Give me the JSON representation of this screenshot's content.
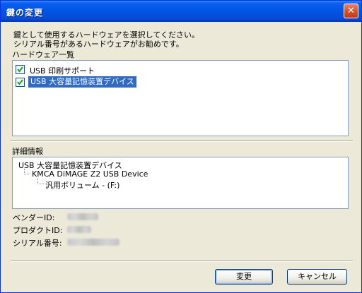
{
  "window": {
    "title": "鍵の変更",
    "close_glyph": "✕"
  },
  "instructions": {
    "line1": "鍵として使用するハードウェアを選択してください。",
    "line2": "シリアル番号があるハードウェアがお勧めです。"
  },
  "hardware": {
    "label": "ハードウェア一覧",
    "items": [
      {
        "label": "USB 印刷サポート",
        "checked": true
      },
      {
        "label": "USB 大容量記憶装置デバイス",
        "checked": true,
        "selected": true
      }
    ]
  },
  "details": {
    "label": "詳細情報",
    "tree": [
      "USB 大容量記憶装置デバイス",
      "KMCA DiMAGE Z2 USB Device",
      "汎用ボリューム - (F:)"
    ],
    "vendor_label": "ベンダーID:",
    "product_label": "プロダクトID:",
    "serial_label": "シリアル番号:"
  },
  "buttons": {
    "ok": "変更",
    "cancel": "キャンセル"
  },
  "colors": {
    "selection": "#316ac5",
    "check": "#21a121"
  }
}
